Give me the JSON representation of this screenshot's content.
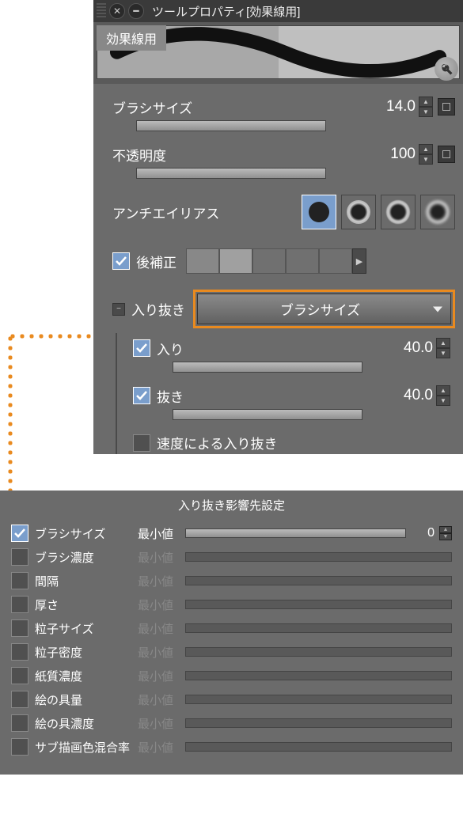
{
  "titlebar": {
    "title": "ツールプロパティ[効果線用]"
  },
  "preset": {
    "tab": "効果線用"
  },
  "props": {
    "brush_size": {
      "label": "ブラシサイズ",
      "value": "14.0"
    },
    "opacity": {
      "label": "不透明度",
      "value": "100"
    },
    "antialias": {
      "label": "アンチエイリアス"
    },
    "post_correct": {
      "label": "後補正"
    },
    "irinuki": {
      "label": "入り抜き",
      "dd_value": "ブラシサイズ"
    },
    "iri": {
      "label": "入り",
      "value": "40.0"
    },
    "nuki": {
      "label": "抜き",
      "value": "40.0"
    },
    "speed": {
      "label": "速度による入り抜き"
    }
  },
  "lower": {
    "title": "入り抜き影響先設定",
    "items": [
      {
        "label": "ブラシサイズ",
        "checked": true,
        "min_label": "最小値",
        "value": "0"
      },
      {
        "label": "ブラシ濃度",
        "checked": false,
        "min_label": "最小値"
      },
      {
        "label": "間隔",
        "checked": false,
        "min_label": "最小値"
      },
      {
        "label": "厚さ",
        "checked": false,
        "min_label": "最小値"
      },
      {
        "label": "粒子サイズ",
        "checked": false,
        "min_label": "最小値"
      },
      {
        "label": "粒子密度",
        "checked": false,
        "min_label": "最小値"
      },
      {
        "label": "紙質濃度",
        "checked": false,
        "min_label": "最小値"
      },
      {
        "label": "絵の具量",
        "checked": false,
        "min_label": "最小値"
      },
      {
        "label": "絵の具濃度",
        "checked": false,
        "min_label": "最小値"
      },
      {
        "label": "サブ描画色混合率",
        "checked": false,
        "min_label": "最小値"
      }
    ]
  },
  "swatch_colors": [
    "#888888",
    "#a0a0a0",
    "#707070",
    "#707070",
    "#707070"
  ]
}
